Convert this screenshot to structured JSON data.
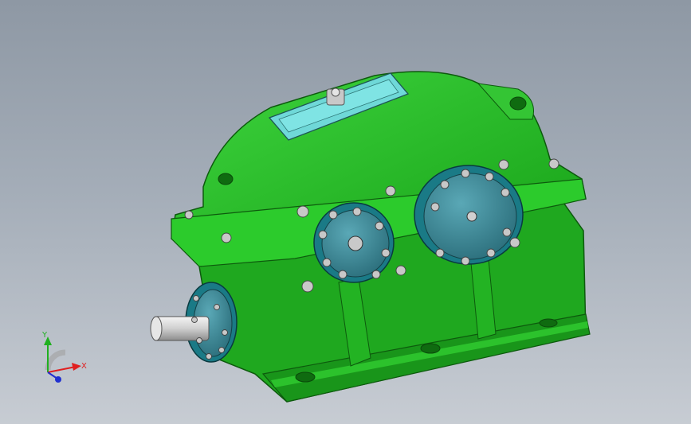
{
  "viewport": {
    "background_top": "#8e98a4",
    "background_bottom": "#c7ccd3"
  },
  "model": {
    "body_color": "#22b822",
    "body_dark": "#168a16",
    "body_light": "#46d046",
    "cap_color": "#3a8a9a",
    "cover_color": "#6fd8d8",
    "bolt_color": "#c8c8c8"
  },
  "triad": {
    "x_label": "X",
    "y_label": "Y",
    "x_color": "#e02020",
    "y_color": "#20b020",
    "z_color": "#2030d0"
  }
}
